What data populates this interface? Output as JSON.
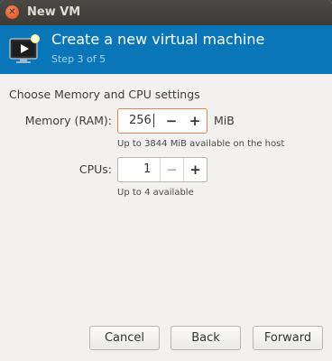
{
  "window": {
    "title": "New VM"
  },
  "header": {
    "title": "Create a new virtual machine",
    "step": "Step 3 of 5"
  },
  "section": {
    "title": "Choose Memory and CPU settings"
  },
  "memory": {
    "label": "Memory (RAM):",
    "value": "256",
    "unit": "MiB",
    "hint": "Up to 3844 MiB available on the host"
  },
  "cpus": {
    "label": "CPUs:",
    "value": "1",
    "hint": "Up to 4 available"
  },
  "stepper": {
    "minus": "−",
    "plus": "+"
  },
  "footer": {
    "cancel": "Cancel",
    "back": "Back",
    "forward": "Forward"
  },
  "colors": {
    "header_bg": "#0a76ba",
    "focus_border": "#e9824d",
    "close_button": "#df4b16"
  }
}
